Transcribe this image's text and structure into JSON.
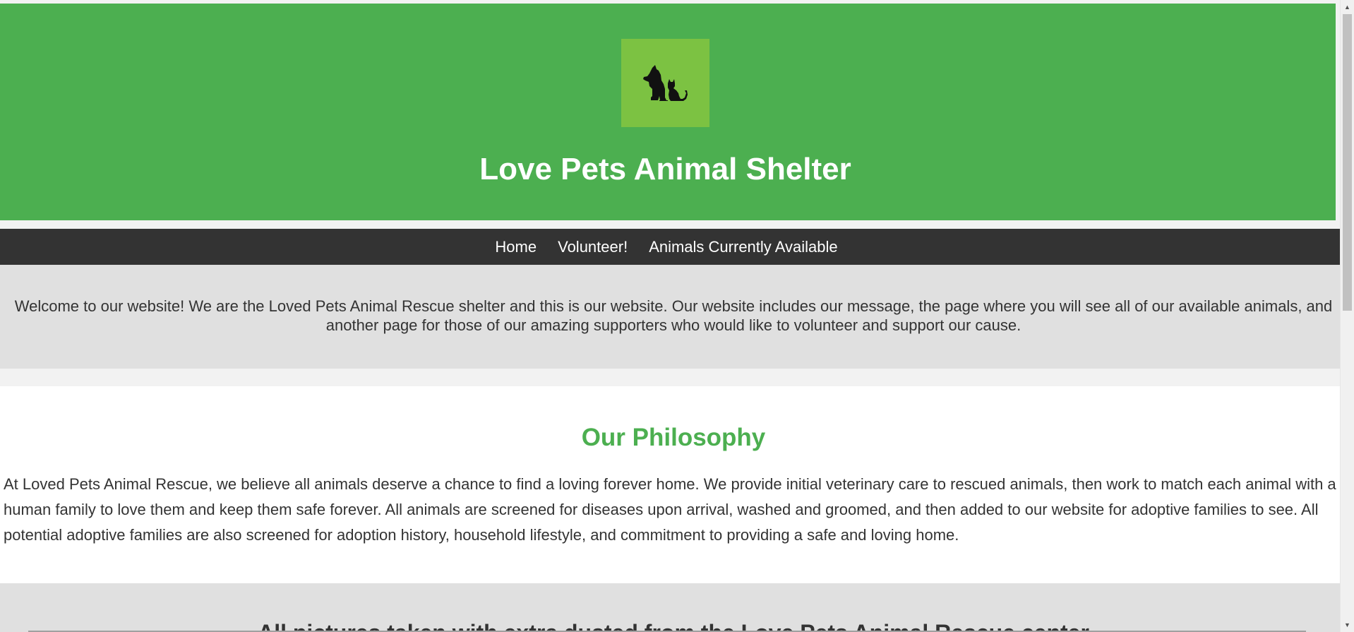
{
  "header": {
    "logo_icon": "dog-and-cat-icon",
    "title": "Love Pets Animal Shelter",
    "bg_color": "#4caf50",
    "logo_bg_color": "#7cc242"
  },
  "nav": {
    "items": [
      {
        "label": "Home"
      },
      {
        "label": "Volunteer!"
      },
      {
        "label": "Animals Currently Available"
      }
    ],
    "bg_color": "#333333"
  },
  "welcome": {
    "text": "Welcome to our website! We are the Loved Pets Animal Rescue shelter and this is our website. Our website includes our message, the page where you will see all of our available animals, and another page for those of our amazing supporters who would like to volunteer and support our cause."
  },
  "philosophy": {
    "title": "Our Philosophy",
    "text": "At Loved Pets Animal Rescue, we believe all animals deserve a chance to find a loving forever home. We provide initial veterinary care to rescued animals, then work to match each animal with a human family to love them and keep them safe forever. All animals are screened for diseases upon arrival, washed and groomed, and then added to our website for adoptive families to see. All potential adoptive families are also screened for adoption history, household lifestyle, and commitment to providing a safe and loving home.",
    "title_color": "#4caf50"
  },
  "bottom": {
    "heading": "All pictures taken with extra dusted from the Love Pets Animal Rescue center"
  },
  "scrollbar": {
    "up_icon": "scroll-up-arrow-icon",
    "down_icon": "scroll-down-arrow-icon"
  }
}
